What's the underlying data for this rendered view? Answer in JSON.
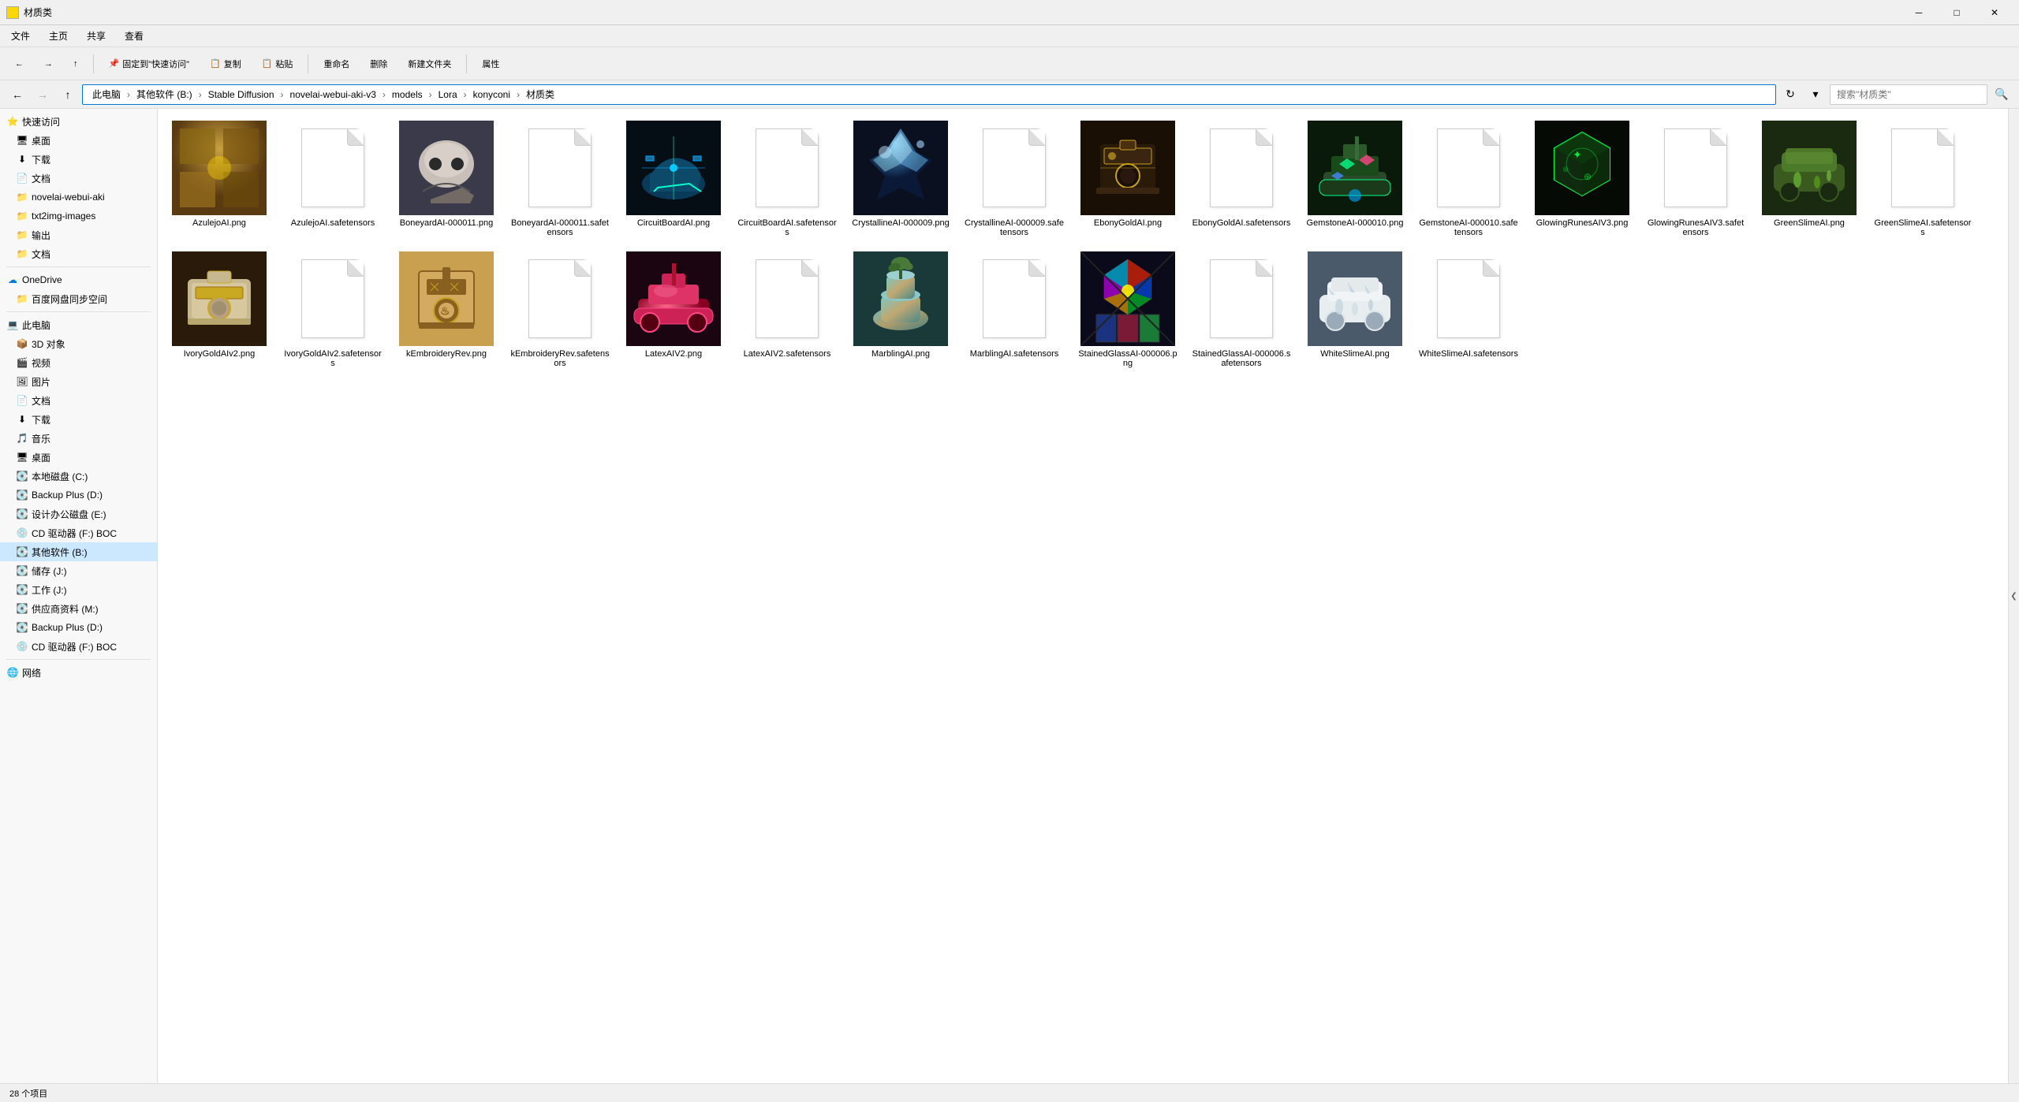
{
  "window": {
    "title": "材质类",
    "icon": "folder"
  },
  "title_bar": {
    "title": "材质类",
    "minimize_label": "─",
    "restore_label": "□",
    "close_label": "✕"
  },
  "menu": {
    "items": [
      "文件",
      "主页",
      "共享",
      "查看"
    ]
  },
  "toolbar": {
    "back_label": "←",
    "forward_label": "→",
    "up_label": "↑",
    "recent_label": "▾"
  },
  "address_bar": {
    "path": "此电脑 > 其他软件 (B:) > Stable Diffusion > novelai-webui-aki-v3 > models > Lora > konyconi > 材质类",
    "breadcrumbs": [
      "此电脑",
      "其他软件 (B:)",
      "Stable Diffusion",
      "novelai-webui-aki-v3",
      "models",
      "Lora",
      "konyconi",
      "材质类"
    ],
    "search_placeholder": "搜索\"材质类\""
  },
  "sidebar": {
    "quick_access_label": "快速访问",
    "items": [
      {
        "id": "quick-access",
        "label": "快速访问",
        "icon": "⭐",
        "indent": 0,
        "expanded": true
      },
      {
        "id": "desktop1",
        "label": "桌面",
        "icon": "🖥",
        "indent": 1
      },
      {
        "id": "download1",
        "label": "下载",
        "icon": "⬇",
        "indent": 1
      },
      {
        "id": "docs1",
        "label": "文档",
        "icon": "📄",
        "indent": 1
      },
      {
        "id": "novelai",
        "label": "novelai-webui-aki",
        "icon": "📁",
        "indent": 1
      },
      {
        "id": "txt2img",
        "label": "txt2img-images",
        "icon": "📁",
        "indent": 1
      },
      {
        "id": "output",
        "label": "输出",
        "icon": "📁",
        "indent": 1
      },
      {
        "id": "docs2",
        "label": "文档",
        "icon": "📁",
        "indent": 1
      },
      {
        "id": "onedrive",
        "label": "OneDrive",
        "icon": "☁",
        "indent": 0
      },
      {
        "id": "baidu",
        "label": "百度网盘同步空间",
        "icon": "📁",
        "indent": 1
      },
      {
        "id": "thispc",
        "label": "此电脑",
        "icon": "💻",
        "indent": 0,
        "expanded": true
      },
      {
        "id": "3d",
        "label": "3D 对象",
        "icon": "📦",
        "indent": 1
      },
      {
        "id": "video",
        "label": "视频",
        "icon": "🎬",
        "indent": 1
      },
      {
        "id": "pics",
        "label": "图片",
        "icon": "🖼",
        "indent": 1
      },
      {
        "id": "docs3",
        "label": "文档",
        "icon": "📄",
        "indent": 1
      },
      {
        "id": "dl",
        "label": "下载",
        "icon": "⬇",
        "indent": 1
      },
      {
        "id": "music",
        "label": "音乐",
        "icon": "🎵",
        "indent": 1
      },
      {
        "id": "desktop2",
        "label": "桌面",
        "icon": "🖥",
        "indent": 1
      },
      {
        "id": "localc",
        "label": "本地磁盘 (C:)",
        "icon": "💽",
        "indent": 1
      },
      {
        "id": "backupd",
        "label": "Backup Plus (D:)",
        "icon": "💽",
        "indent": 1
      },
      {
        "id": "office",
        "label": "设计办公磁盘 (E:)",
        "icon": "💽",
        "indent": 1
      },
      {
        "id": "cdf",
        "label": "CD 驱动器 (F:) BOC",
        "icon": "💿",
        "indent": 1
      },
      {
        "id": "othersw",
        "label": "其他软件 (B:)",
        "icon": "💽",
        "indent": 1,
        "selected": true
      },
      {
        "id": "storage",
        "label": "储存 (J:)",
        "icon": "💽",
        "indent": 1
      },
      {
        "id": "work",
        "label": "工作 (J:)",
        "icon": "💽",
        "indent": 1
      },
      {
        "id": "supply",
        "label": "供应商资料 (M:)",
        "icon": "💽",
        "indent": 1
      },
      {
        "id": "backupd2",
        "label": "Backup Plus (D:)",
        "icon": "💽",
        "indent": 1
      },
      {
        "id": "cdf2",
        "label": "CD 驱动器 (F:) BOC",
        "icon": "💿",
        "indent": 1
      },
      {
        "id": "network",
        "label": "网络",
        "icon": "🌐",
        "indent": 0
      }
    ]
  },
  "files": [
    {
      "id": 1,
      "name": "AzulejoAI.png",
      "type": "image",
      "thumb_color": "#8B6914",
      "has_image": true
    },
    {
      "id": 2,
      "name": "AzulejoAI.safetensors",
      "type": "doc",
      "has_image": false
    },
    {
      "id": 3,
      "name": "BoneyardAI-000011.png",
      "type": "image",
      "thumb_color": "#666",
      "has_image": true
    },
    {
      "id": 4,
      "name": "BoneyardAI-000011.safetensors",
      "type": "doc",
      "has_image": false
    },
    {
      "id": 5,
      "name": "CircuitBoardAI.png",
      "type": "image",
      "thumb_color": "#0d4a6e",
      "has_image": true
    },
    {
      "id": 6,
      "name": "CircuitBoardAI.safetensors",
      "type": "doc",
      "has_image": false
    },
    {
      "id": 7,
      "name": "CrystallineAI-000009.png",
      "type": "image",
      "thumb_color": "#1a3a5c",
      "has_image": true
    },
    {
      "id": 8,
      "name": "CrystallineAI-000009.safetensors",
      "type": "doc",
      "has_image": false
    },
    {
      "id": 9,
      "name": "EbonyGoldAI.png",
      "type": "image",
      "thumb_color": "#2a1a0a",
      "has_image": true
    },
    {
      "id": 10,
      "name": "EbonyGoldAI.safetensors",
      "type": "doc",
      "has_image": false
    },
    {
      "id": 11,
      "name": "GemstoneAI-000010.png",
      "type": "image",
      "thumb_color": "#1a4a2a",
      "has_image": true
    },
    {
      "id": 12,
      "name": "GemstoneAI-000010.safetensors",
      "type": "doc",
      "has_image": false
    },
    {
      "id": 13,
      "name": "GlowingRunesAIV3.png",
      "type": "image",
      "thumb_color": "#0a2a1a",
      "has_image": true
    },
    {
      "id": 14,
      "name": "GlowingRunesAIV3.safetensors",
      "type": "doc",
      "has_image": false
    },
    {
      "id": 15,
      "name": "GreenSlimeAI.png",
      "type": "image",
      "thumb_color": "#2a4a1a",
      "has_image": true
    },
    {
      "id": 16,
      "name": "GreenSlimeAI.safetensors",
      "type": "doc",
      "has_image": false
    },
    {
      "id": 17,
      "name": "IvoryGoldAIv2.png",
      "type": "image",
      "thumb_color": "#5a3a1a",
      "has_image": true
    },
    {
      "id": 18,
      "name": "IvoryGoldAIv2.safetensors",
      "type": "doc",
      "has_image": false
    },
    {
      "id": 19,
      "name": "kEmbroideryRev.png",
      "type": "image",
      "thumb_color": "#8B6914",
      "has_image": true
    },
    {
      "id": 20,
      "name": "kEmbroideryRev.safetensors",
      "type": "doc",
      "has_image": false
    },
    {
      "id": 21,
      "name": "LatexAIV2.png",
      "type": "image",
      "thumb_color": "#6a1a2a",
      "has_image": true
    },
    {
      "id": 22,
      "name": "LatexAIV2.safetensors",
      "type": "doc",
      "has_image": false
    },
    {
      "id": 23,
      "name": "MarblingAI.png",
      "type": "image",
      "thumb_color": "#2a4a5a",
      "has_image": true
    },
    {
      "id": 24,
      "name": "MarblingAI.safetensors",
      "type": "doc",
      "has_image": false
    },
    {
      "id": 25,
      "name": "StainedGlassAI-000006.png",
      "type": "image",
      "thumb_color": "#1a1a4a",
      "has_image": true
    },
    {
      "id": 26,
      "name": "StainedGlassAI-000006.safetensors",
      "type": "doc",
      "has_image": false
    },
    {
      "id": 27,
      "name": "WhiteSlimeAI.png",
      "type": "image",
      "thumb_color": "#9a9a9a",
      "has_image": true
    },
    {
      "id": 28,
      "name": "WhiteSlimeAI.safetensors",
      "type": "doc",
      "has_image": false
    }
  ],
  "status_bar": {
    "item_count": "28 个项目"
  },
  "colors": {
    "accent": "#0078d7",
    "selected_bg": "#cce8ff",
    "hover_bg": "#e8f4ff"
  }
}
